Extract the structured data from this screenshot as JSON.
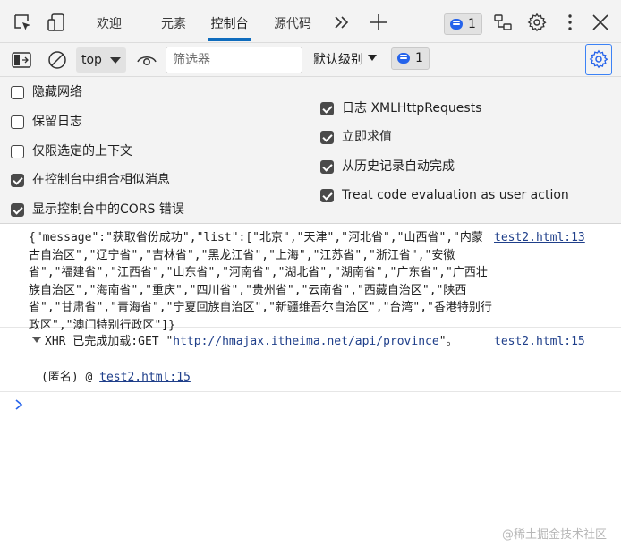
{
  "tabs": [
    {
      "label": "欢迎",
      "active": false
    },
    {
      "label": "元素",
      "active": false
    },
    {
      "label": "控制台",
      "active": true
    },
    {
      "label": "源代码",
      "active": false
    }
  ],
  "issues_count": "1",
  "toolbar": {
    "context": "top",
    "filter_placeholder": "筛选器",
    "levels": "默认级别",
    "messages_count": "1"
  },
  "settings": {
    "left": [
      {
        "label": "隐藏网络",
        "checked": false
      },
      {
        "label": "保留日志",
        "checked": false
      },
      {
        "label": "仅限选定的上下文",
        "checked": false
      },
      {
        "label": "在控制台中组合相似消息",
        "checked": true
      },
      {
        "label": "显示控制台中的CORS 错误",
        "checked": true
      }
    ],
    "right": [
      {
        "label": "日志 XMLHttpRequests",
        "checked": true
      },
      {
        "label": "立即求值",
        "checked": true
      },
      {
        "label": "从历史记录自动完成",
        "checked": true
      },
      {
        "label": "Treat code evaluation as user action",
        "checked": true
      }
    ]
  },
  "console": {
    "message1": {
      "text": "{\"message\":\"获取省份成功\",\"list\":[\"北京\",\"天津\",\"河北省\",\"山西省\",\"内蒙古自治区\",\"辽宁省\",\"吉林省\",\"黑龙江省\",\"上海\",\"江苏省\",\"浙江省\",\"安徽省\",\"福建省\",\"江西省\",\"山东省\",\"河南省\",\"湖北省\",\"湖南省\",\"广东省\",\"广西壮族自治区\",\"海南省\",\"重庆\",\"四川省\",\"贵州省\",\"云南省\",\"西藏自治区\",\"陕西省\",\"甘肃省\",\"青海省\",\"宁夏回族自治区\",\"新疆维吾尔自治区\",\"台湾\",\"香港特别行政区\",\"澳门特别行政区\"]}",
      "source": "test2.html:13"
    },
    "message2": {
      "prefix": "XHR 已完成加载:GET \"",
      "url": "http://hmajax.itheima.net/api/province",
      "suffix": "\"。",
      "source": "test2.html:15",
      "stack_prefix": "(匿名) @ ",
      "stack_link": "test2.html:15"
    }
  },
  "watermark": "@稀土掘金技术社区",
  "colors": {
    "accent": "#0f6cbd",
    "link": "#1f3f8a",
    "badge_blue": "#2563eb"
  }
}
